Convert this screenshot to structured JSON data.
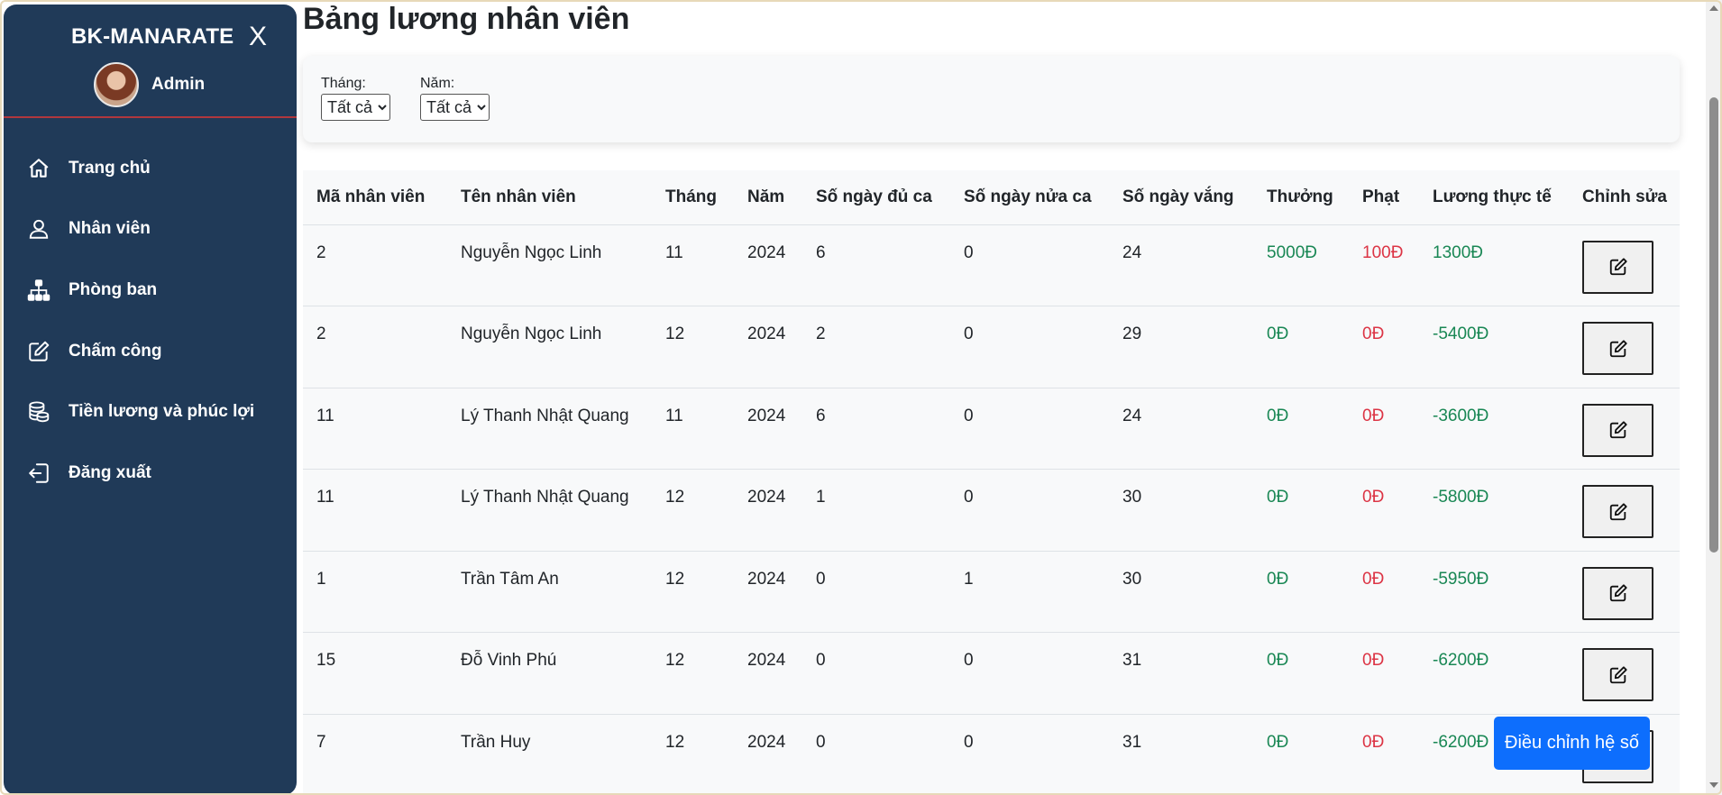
{
  "sidebar": {
    "brand": "BK-MANARATE",
    "close": "X",
    "user": "Admin",
    "items": [
      {
        "label": "Trang chủ",
        "icon": "home-icon"
      },
      {
        "label": "Nhân viên",
        "icon": "user-icon"
      },
      {
        "label": "Phòng ban",
        "icon": "org-chart-icon"
      },
      {
        "label": "Chấm công",
        "icon": "edit-icon"
      },
      {
        "label": "Tiền lương và phúc lợi",
        "icon": "coins-icon"
      },
      {
        "label": "Đăng xuất",
        "icon": "logout-icon"
      }
    ]
  },
  "page": {
    "title": "Bảng lương nhân viên"
  },
  "filters": {
    "month": {
      "label": "Tháng:",
      "value": "Tất cả"
    },
    "year": {
      "label": "Năm:",
      "value": "Tất cả"
    }
  },
  "table": {
    "headers": [
      "Mã nhân viên",
      "Tên nhân viên",
      "Tháng",
      "Năm",
      "Số ngày đủ ca",
      "Số ngày nửa ca",
      "Số ngày vắng",
      "Thưởng",
      "Phạt",
      "Lương thực tế",
      "Chỉnh sửa"
    ],
    "rows": [
      [
        "2",
        "Nguyễn Ngọc Linh",
        "11",
        "2024",
        "6",
        "0",
        "24",
        "5000Đ",
        "100Đ",
        "1300Đ"
      ],
      [
        "2",
        "Nguyễn Ngọc Linh",
        "12",
        "2024",
        "2",
        "0",
        "29",
        "0Đ",
        "0Đ",
        "-5400Đ"
      ],
      [
        "11",
        "Lý Thanh Nhật Quang",
        "11",
        "2024",
        "6",
        "0",
        "24",
        "0Đ",
        "0Đ",
        "-3600Đ"
      ],
      [
        "11",
        "Lý Thanh Nhật Quang",
        "12",
        "2024",
        "1",
        "0",
        "30",
        "0Đ",
        "0Đ",
        "-5800Đ"
      ],
      [
        "1",
        "Trần Tâm An",
        "12",
        "2024",
        "0",
        "1",
        "30",
        "0Đ",
        "0Đ",
        "-5950Đ"
      ],
      [
        "15",
        "Đỗ Vinh Phú",
        "12",
        "2024",
        "0",
        "0",
        "31",
        "0Đ",
        "0Đ",
        "-6200Đ"
      ],
      [
        "7",
        "Trần Huy",
        "12",
        "2024",
        "0",
        "0",
        "31",
        "0Đ",
        "0Đ",
        "-6200Đ"
      ]
    ]
  },
  "actions": {
    "adjust": "Điều chỉnh hệ số"
  },
  "colors": {
    "sidebar": "#203a58",
    "positive": "#198754",
    "negative": "#dc3545",
    "primary": "#0d6efd"
  }
}
